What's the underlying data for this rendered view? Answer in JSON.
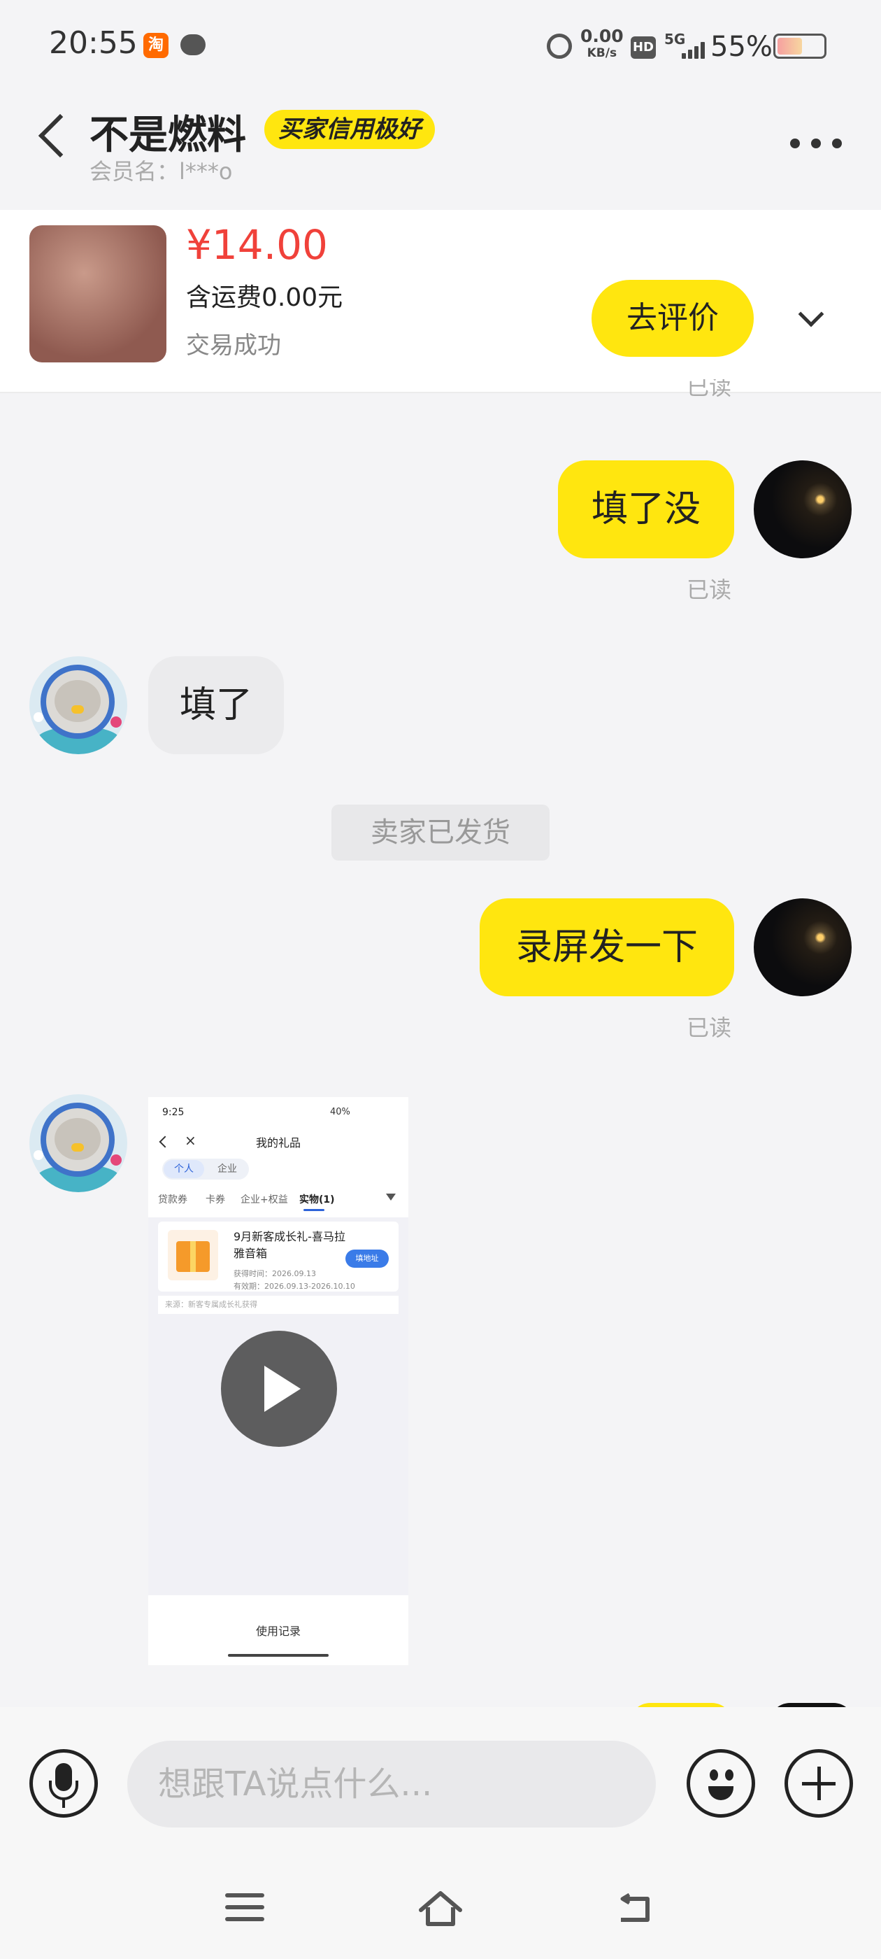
{
  "status_bar": {
    "time": "20:55",
    "taobao_badge": "淘",
    "net_speed_value": "0.00",
    "net_speed_unit": "KB/s",
    "hd": "HD",
    "signal": "5G",
    "battery": "55%",
    "battery_level": 0.55
  },
  "header": {
    "title": "不是燃料",
    "badge": "买家信用极好",
    "member": "会员名：l***o"
  },
  "product": {
    "price": "¥14.00",
    "shipping": "含运费0.00元",
    "status": "交易成功",
    "review_button": "去评价"
  },
  "messages": {
    "read_top": "已读",
    "m1_text": "填了没",
    "m1_read": "已读",
    "m2_text": "填了",
    "system": "卖家已发货",
    "m3_text": "录屏发一下",
    "m3_read": "已读"
  },
  "video": {
    "time": "9:25",
    "status_right": "40%",
    "title": "我的礼品",
    "seg_personal": "个人",
    "seg_company": "企业",
    "tabs": [
      "贷款券",
      "卡券",
      "企业+权益",
      "实物(1)"
    ],
    "item_title": "9月新客成长礼-喜马拉雅音箱",
    "item_time": "获得时间：2026.09.13",
    "item_valid": "有效期：2026.09.13-2026.10.10",
    "addr_button": "填地址",
    "source": "来源：新客专属成长礼获得",
    "footer": "使用记录"
  },
  "composer": {
    "placeholder": "想跟TA说点什么..."
  },
  "colors": {
    "accent_yellow": "#ffe60f",
    "price_red": "#f0413a",
    "background": "#f4f4f6"
  },
  "icons": [
    "back-icon",
    "more-icon",
    "chevron-down-icon",
    "play-icon",
    "mic-icon",
    "emoji-icon",
    "add-icon",
    "menu-icon",
    "home-icon",
    "return-icon"
  ]
}
